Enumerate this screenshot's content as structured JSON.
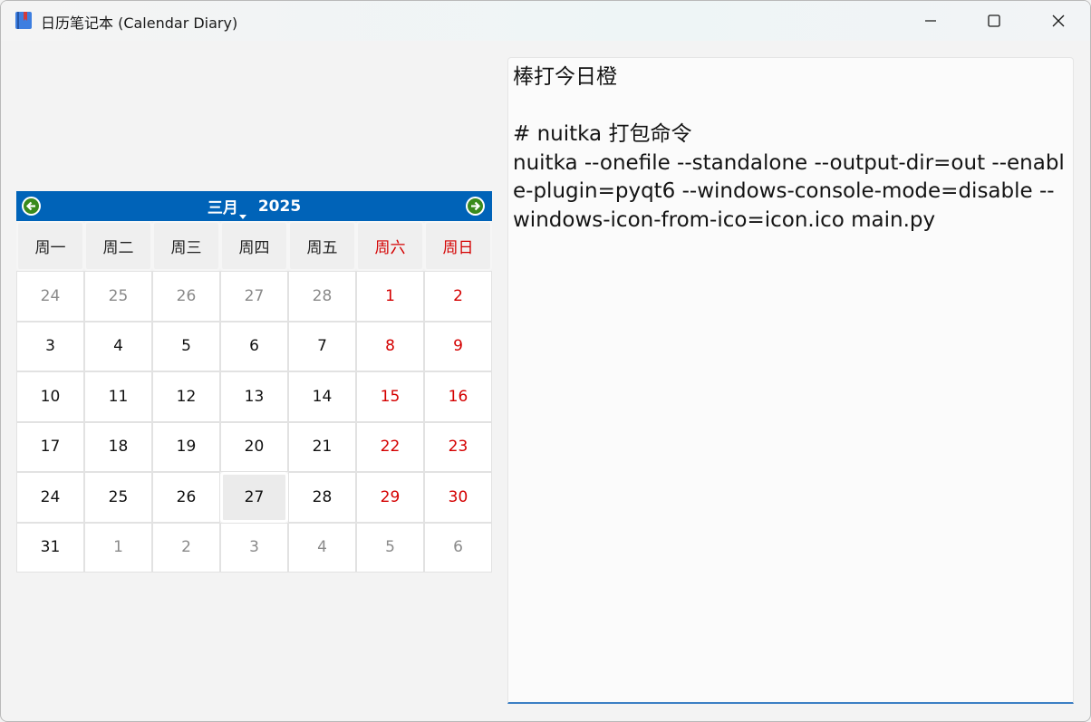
{
  "window": {
    "title": "日历笔记本 (Calendar Diary)",
    "controls": [
      "minimize",
      "maximize",
      "close"
    ]
  },
  "calendar": {
    "month_label": "三月",
    "year_label": "2025",
    "prev_icon": "arrow-left-icon",
    "next_icon": "arrow-right-icon",
    "header_color": "#0063b8",
    "weekend_color": "#d40000",
    "weekdays": [
      "周一",
      "周二",
      "周三",
      "周四",
      "周五",
      "周六",
      "周日"
    ],
    "weeks": [
      [
        "24",
        "25",
        "26",
        "27",
        "28",
        "1",
        "2"
      ],
      [
        "3",
        "4",
        "5",
        "6",
        "7",
        "8",
        "9"
      ],
      [
        "10",
        "11",
        "12",
        "13",
        "14",
        "15",
        "16"
      ],
      [
        "17",
        "18",
        "19",
        "20",
        "21",
        "22",
        "23"
      ],
      [
        "24",
        "25",
        "26",
        "27",
        "28",
        "29",
        "30"
      ],
      [
        "31",
        "1",
        "2",
        "3",
        "4",
        "5",
        "6"
      ]
    ],
    "other_month_cells": [
      "0-0",
      "0-1",
      "0-2",
      "0-3",
      "0-4",
      "5-1",
      "5-2",
      "5-3",
      "5-4",
      "5-5",
      "5-6"
    ],
    "selected_cell": "4-3"
  },
  "editor": {
    "text": "棒打今日橙\n\n# nuitka 打包命令\nnuitka --onefile --standalone --output-dir=out --enable-plugin=pyqt6 --windows-console-mode=disable --windows-icon-from-ico=icon.ico main.py",
    "focus_color": "#3c7fc4"
  }
}
